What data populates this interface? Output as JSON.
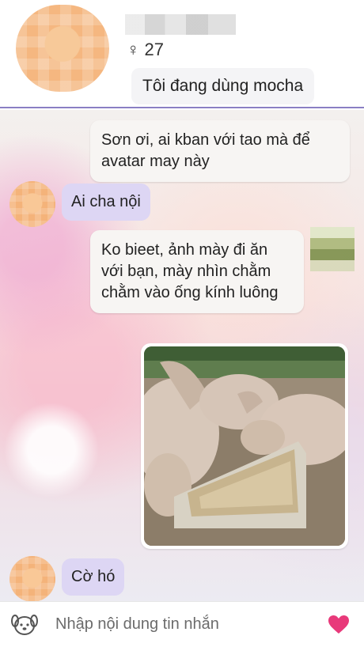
{
  "header": {
    "age": "27",
    "gender_symbol": "♀",
    "status": "Tôi đang dùng mocha"
  },
  "messages": [
    {
      "id": "m1",
      "side": "out",
      "text": "Sơn ơi, ai kban với tao mà để avatar may này"
    },
    {
      "id": "m2",
      "side": "in",
      "text": "Ai cha nội"
    },
    {
      "id": "m3",
      "side": "out",
      "text": "Ko bieet, ảnh mày đi ăn với bạn, mày nhìn chằm chằm vào ống kính luông"
    },
    {
      "id": "m4",
      "side": "out",
      "type": "image",
      "alt": "pigs eating from a trough"
    },
    {
      "id": "m5",
      "side": "in",
      "text": "Cờ hó"
    }
  ],
  "input": {
    "placeholder": "Nhập nội dung tin nhắn"
  },
  "colors": {
    "accent": "#8a7fc4",
    "incoming_bubble": "#ddd6f4",
    "outgoing_bubble": "#f7f5f3",
    "heart": "#e8397a"
  },
  "icons": {
    "emoji": "dog-face-icon",
    "send": "heart-icon"
  }
}
